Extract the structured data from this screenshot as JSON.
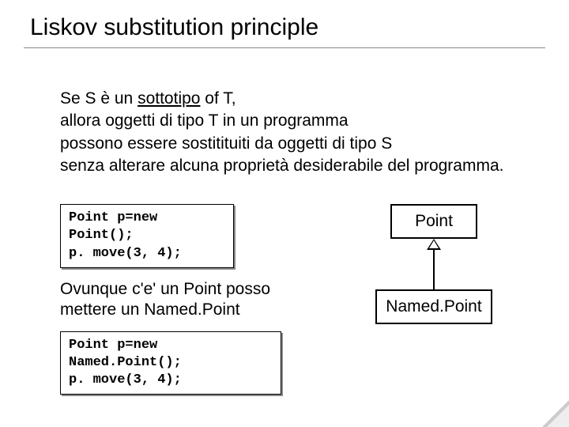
{
  "title": "Liskov substitution principle",
  "body": {
    "line1a": "Se S è un ",
    "line1b": "sottotipo",
    "line1c": " of T,",
    "line2": "allora oggetti di tipo T in un programma",
    "line3": "possono essere sostitituiti da oggetti di tipo S",
    "line4": "senza alterare alcuna proprietà desiderabile del programma."
  },
  "code1": {
    "l1": "Point p=new",
    "l2": "Point();",
    "l3": "p. move(3, 4);"
  },
  "mid": {
    "l1": "Ovunque c'e' un Point posso",
    "l2": "mettere un Named.Point"
  },
  "code2": {
    "l1": "Point p=new Named.Point();",
    "l2": "p. move(3, 4);"
  },
  "uml": {
    "parent": "Point",
    "child": "Named.Point"
  }
}
